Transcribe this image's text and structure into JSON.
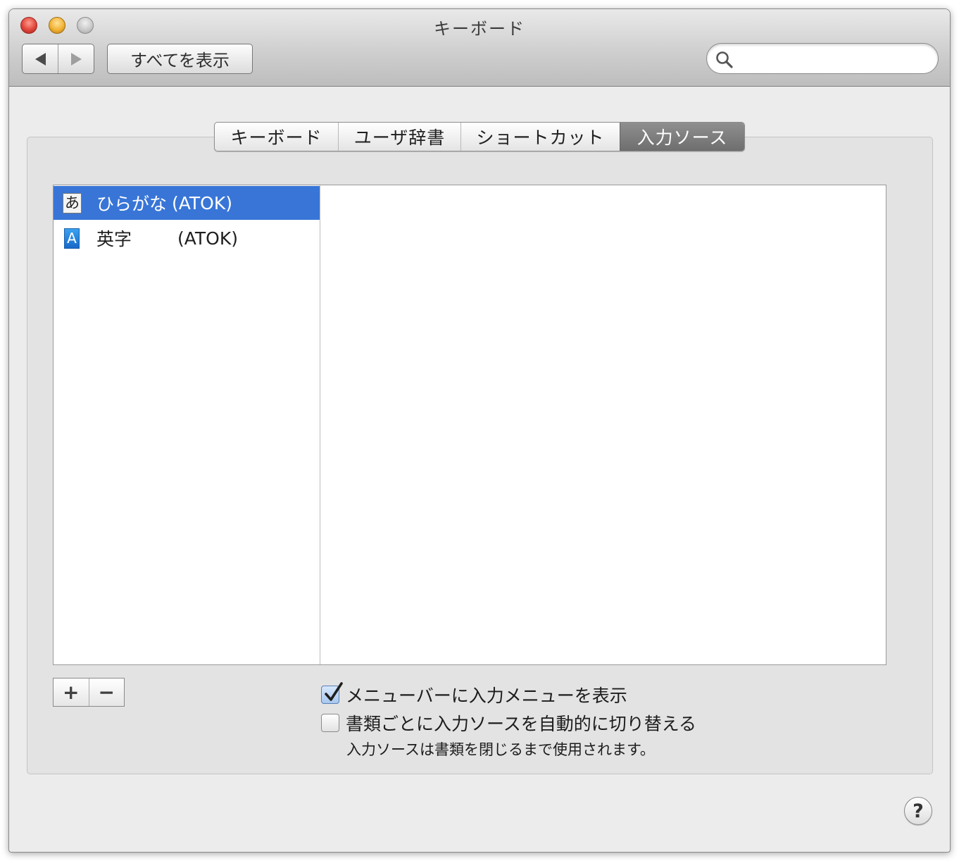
{
  "window": {
    "title": "キーボード"
  },
  "toolbar": {
    "show_all_label": "すべてを表示",
    "search": {
      "value": "",
      "placeholder": ""
    }
  },
  "tabs": [
    {
      "label": "キーボード",
      "selected": false
    },
    {
      "label": "ユーザ辞書",
      "selected": false
    },
    {
      "label": "ショートカット",
      "selected": false
    },
    {
      "label": "入力ソース",
      "selected": true
    }
  ],
  "input_sources": [
    {
      "icon_glyph": "あ",
      "icon": "hiragana-icon",
      "name": "ひらがな",
      "engine": "(ATOK)",
      "selected": true
    },
    {
      "icon_glyph": "A",
      "icon": "alphanumeric-icon",
      "name": "英字",
      "engine": "(ATOK)",
      "selected": false
    }
  ],
  "list_controls": {
    "add_label": "+",
    "remove_label": "−"
  },
  "options": {
    "show_input_menu": {
      "label": "メニューバーに入力メニューを表示",
      "checked": true
    },
    "auto_switch": {
      "label": "書類ごとに入力ソースを自動的に切り替える",
      "checked": false
    },
    "auto_switch_note": "入力ソースは書類を閉じるまで使用されます。"
  },
  "help_label": "?",
  "colors": {
    "selection": "#3875d7",
    "selected_tab": "#7f7f7f",
    "panel": "#e3e3e3"
  }
}
